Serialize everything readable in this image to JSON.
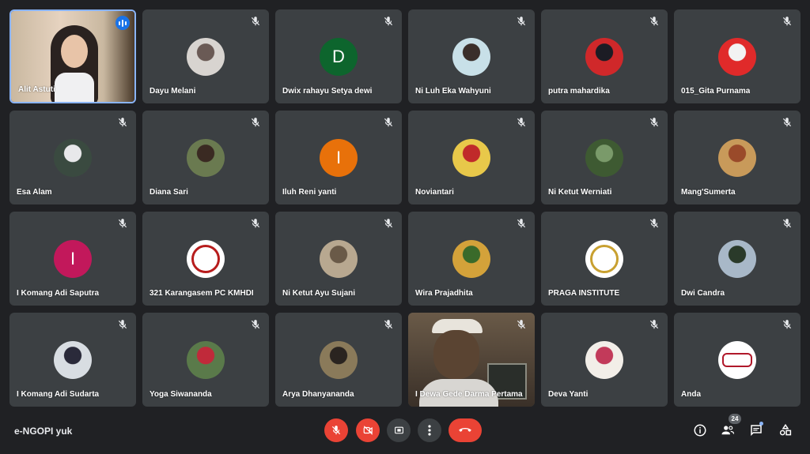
{
  "meeting": {
    "title": "e-NGOPI yuk"
  },
  "participants": [
    {
      "name": "Alit Astuti",
      "kind": "video-speaking",
      "colors": [
        "#c9b8a0",
        "#2a2220",
        "#e6d3c0"
      ]
    },
    {
      "name": "Dayu Melani",
      "kind": "photo",
      "colors": [
        "#d8d4d0",
        "#6a5a55"
      ]
    },
    {
      "name": "Dwix rahayu Setya dewi",
      "kind": "letter",
      "initial": "D",
      "bg": "#0d652d"
    },
    {
      "name": "Ni Luh Eka Wahyuni",
      "kind": "photo",
      "colors": [
        "#c8e0e8",
        "#3a2e2a"
      ]
    },
    {
      "name": "putra mahardika",
      "kind": "photo",
      "colors": [
        "#d0282a",
        "#1c1c24"
      ]
    },
    {
      "name": "015_Gita Purnama",
      "kind": "photo",
      "colors": [
        "#e02a2a",
        "#f2f2f2"
      ]
    },
    {
      "name": "Esa Alam",
      "kind": "photo",
      "colors": [
        "#3a4a40",
        "#e8e8ea"
      ]
    },
    {
      "name": "Diana Sari",
      "kind": "photo",
      "colors": [
        "#6a7a50",
        "#3a2a22"
      ]
    },
    {
      "name": "Iluh Reni yanti",
      "kind": "letter",
      "initial": "I",
      "bg": "#e8710a"
    },
    {
      "name": "Noviantari",
      "kind": "photo",
      "colors": [
        "#e8c84a",
        "#c02a2a"
      ]
    },
    {
      "name": "Ni Ketut Werniati",
      "kind": "photo",
      "colors": [
        "#3e5a32",
        "#7a9a6a"
      ]
    },
    {
      "name": "Mang'Sumerta",
      "kind": "photo",
      "colors": [
        "#c89a5a",
        "#9a4a2a"
      ]
    },
    {
      "name": "I Komang Adi Saputra",
      "kind": "letter",
      "initial": "I",
      "bg": "#c2185b"
    },
    {
      "name": "321 Karangasem PC KMHDI",
      "kind": "logo-red",
      "colors": [
        "#ffffff",
        "#b71c1c"
      ]
    },
    {
      "name": "Ni Ketut Ayu Sujani",
      "kind": "photo",
      "colors": [
        "#b8a890",
        "#6a5a48"
      ]
    },
    {
      "name": "Wira Prajadhita",
      "kind": "photo",
      "colors": [
        "#d4a23a",
        "#3a6a2a"
      ]
    },
    {
      "name": "PRAGA INSTITUTE",
      "kind": "logo-gold",
      "colors": [
        "#ffffff",
        "#c8a030"
      ]
    },
    {
      "name": "Dwi Candra",
      "kind": "photo",
      "colors": [
        "#a8b8c8",
        "#2a3a2a"
      ]
    },
    {
      "name": "I Komang Adi Sudarta",
      "kind": "photo",
      "colors": [
        "#d8dde2",
        "#2a2a3a"
      ]
    },
    {
      "name": "Yoga Siwananda",
      "kind": "photo",
      "colors": [
        "#5a7a4a",
        "#c02a3a"
      ]
    },
    {
      "name": "Arya Dhanyananda",
      "kind": "photo",
      "colors": [
        "#8a7a5a",
        "#2a2420"
      ]
    },
    {
      "name": "I Dewa Gede Darma Pertama",
      "kind": "video",
      "colors": [
        "#6a5a48",
        "#3a3028"
      ]
    },
    {
      "name": "Deva Yanti",
      "kind": "photo",
      "colors": [
        "#f2eee8",
        "#c23a5a"
      ]
    },
    {
      "name": "Anda",
      "kind": "logo-rdi",
      "colors": [
        "#ffffff",
        "#b0182a"
      ]
    }
  ],
  "participant_count": "24",
  "controls": [
    {
      "name": "mic-off",
      "color": "#ea4335"
    },
    {
      "name": "camera-off",
      "color": "#ea4335"
    },
    {
      "name": "present",
      "color": "#3c4043"
    },
    {
      "name": "more-options",
      "color": "#3c4043"
    },
    {
      "name": "leave-call",
      "color": "#ea4335"
    }
  ],
  "right_controls": [
    "info-icon",
    "people-icon",
    "chat-icon",
    "activities-icon"
  ],
  "accent": "#8ab4f8"
}
